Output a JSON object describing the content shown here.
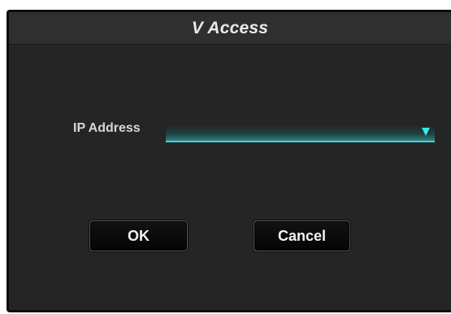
{
  "dialog": {
    "title": "V Access",
    "ip_address": {
      "label": "IP Address",
      "value": "",
      "icon": "dropdown-triangle-icon"
    },
    "buttons": {
      "ok_label": "OK",
      "cancel_label": "Cancel"
    }
  },
  "colors": {
    "background": "#252525",
    "accent": "#49d0d2",
    "text": "#e9e9e9"
  }
}
